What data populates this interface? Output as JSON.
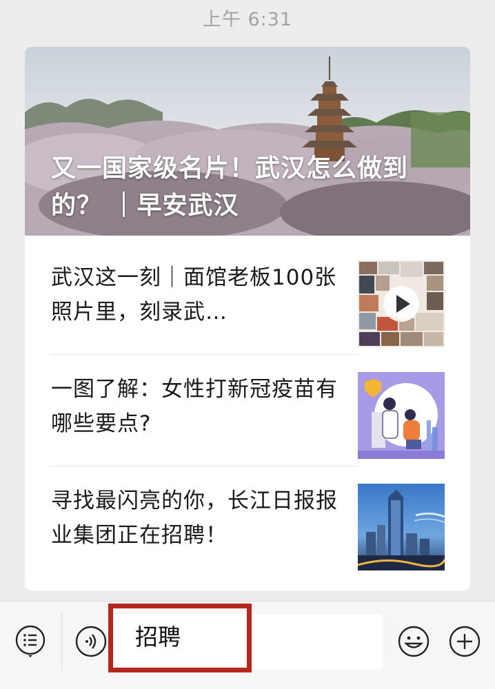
{
  "chat": {
    "timestamp": "上午 6:31"
  },
  "feed": {
    "hero": {
      "title": "又一国家级名片！武汉怎么做到的？ ｜早安武汉"
    },
    "articles": [
      {
        "title": "武汉这一刻｜面馆老板100张照片里，刻录武…",
        "thumb": "photo-collage-video",
        "has_video": true
      },
      {
        "title": "一图了解：女性打新冠疫苗有哪些要点?",
        "thumb": "vaccine-illustration",
        "has_video": false
      },
      {
        "title": "寻找最闪亮的你，长江日报报业集团正在招聘！",
        "thumb": "city-skyline-night",
        "has_video": false
      }
    ]
  },
  "input_bar": {
    "menu_icon": "menu-list-icon",
    "voice_icon": "voice-icon",
    "input_value": "招聘",
    "emoji_icon": "emoji-icon",
    "add_icon": "plus-circle-icon"
  },
  "colors": {
    "background": "#ededed",
    "card": "#ffffff",
    "highlight": "#b3271e",
    "timestamp": "#a3a3a3"
  }
}
